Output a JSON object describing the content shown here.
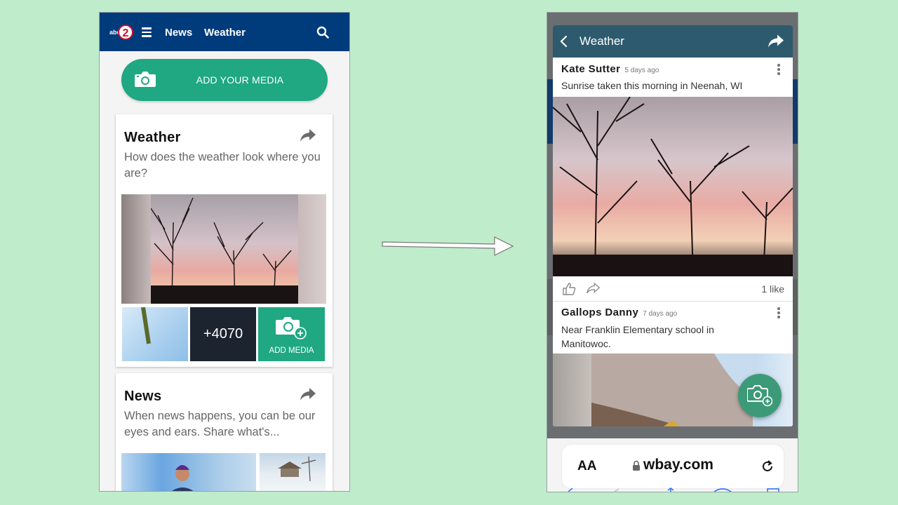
{
  "left_phone": {
    "header": {
      "logo": "abc2",
      "nav_news": "News",
      "nav_weather": "Weather",
      "search_icon": "search-icon"
    },
    "add_media_button": {
      "label": "ADD YOUR MEDIA",
      "icon": "camera-icon"
    },
    "weather_card": {
      "title": "Weather",
      "description": "How does the weather look where you are?",
      "more_count": "+4070",
      "add_media_label": "ADD MEDIA"
    },
    "news_card": {
      "title": "News",
      "description": "When news happens, you can be our eyes and ears. Share what's..."
    }
  },
  "right_phone": {
    "header": {
      "title": "Weather"
    },
    "posts": [
      {
        "author": "Kate Sutter",
        "time": "5 days ago",
        "text": "Sunrise taken this morning in Neenah, WI",
        "likes": "1 like"
      },
      {
        "author": "Gallops Danny",
        "time": "7 days ago",
        "text": "Near Franklin Elementary school in Manitowoc."
      }
    ],
    "browser": {
      "text_size": "AA",
      "url": "wbay.com"
    }
  },
  "colors": {
    "background": "#bfeccb",
    "header_blue": "#003b7c",
    "accent_green": "#1fa882",
    "sheet_header": "#2e5a6e"
  }
}
